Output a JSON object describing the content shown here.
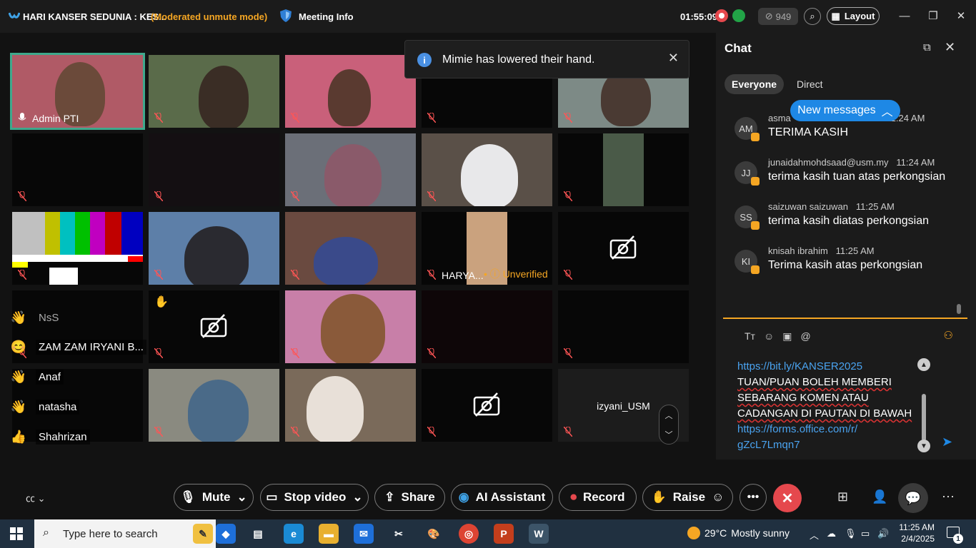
{
  "titlebar": {
    "title": "HARI KANSER SEDUNIA : KES...",
    "mode": "(Moderated unmute mode)",
    "meeting_info": "Meeting Info",
    "time": "01:55:09",
    "participant_count": "949",
    "layout_label": "Layout"
  },
  "tiles": [
    {
      "name": "Admin PTI"
    },
    {
      "name": ""
    },
    {
      "name": ""
    },
    {
      "name": ""
    },
    {
      "name": ""
    },
    {
      "name": ""
    },
    {
      "name": ""
    },
    {
      "name": ""
    },
    {
      "name": ""
    },
    {
      "name": ""
    },
    {
      "name": ""
    },
    {
      "name": ""
    },
    {
      "name": ""
    },
    {
      "name": "HARYA...",
      "badge": "Unverified"
    },
    {
      "name": ""
    },
    {
      "name": ""
    },
    {
      "name": ""
    },
    {
      "name": ""
    },
    {
      "name": ""
    },
    {
      "name": ""
    },
    {
      "name": ""
    },
    {
      "name": ""
    },
    {
      "name": ""
    },
    {
      "name": ""
    },
    {
      "name": "izyani_USM"
    }
  ],
  "raised_hands": [
    {
      "name": "NsS"
    },
    {
      "name": "ZAM ZAM IRYANI B..."
    },
    {
      "name": "Anaf"
    },
    {
      "name": "natasha"
    },
    {
      "name": "Shahrizan"
    }
  ],
  "toast": {
    "message": "Mimie has lowered their hand."
  },
  "chat": {
    "title": "Chat",
    "tab_everyone": "Everyone",
    "tab_direct": "Direct",
    "new_messages": "New messages",
    "messages": [
      {
        "initials": "AM",
        "sender": "asma",
        "time": "11:24 AM",
        "text": "TERIMA KASIH"
      },
      {
        "initials": "JJ",
        "sender": "junaidahmohdsaad@usm.my",
        "time": "11:24 AM",
        "text": "terima kasih tuan atas perkongsian"
      },
      {
        "initials": "SS",
        "sender": "saizuwan saizuwan",
        "time": "11:25 AM",
        "text": "terima kasih diatas perkongsian"
      },
      {
        "initials": "KI",
        "sender": "knisah ibrahim",
        "time": "11:25 AM",
        "text": "Terima kasih atas perkongsian"
      }
    ],
    "compose": {
      "link1": "https://bit.ly/KANSER2025",
      "line1": "TUAN/PUAN BOLEH MEMBERI",
      "line2": "SEBARANG KOMEN ATAU",
      "line3": "CADANGAN DI PAUTAN DI BAWAH",
      "link2a": "https://forms.office.com/r/",
      "link2b": "gZcL7Lmqn7"
    }
  },
  "controls": {
    "mute": "Mute",
    "stop_video": "Stop video",
    "share": "Share",
    "ai_assistant": "AI Assistant",
    "record": "Record",
    "raise": "Raise"
  },
  "taskbar": {
    "search_placeholder": "Type here to search",
    "temperature": "29°C",
    "weather": "Mostly sunny",
    "time": "11:25 AM",
    "date": "2/4/2025",
    "notification_count": "1"
  }
}
